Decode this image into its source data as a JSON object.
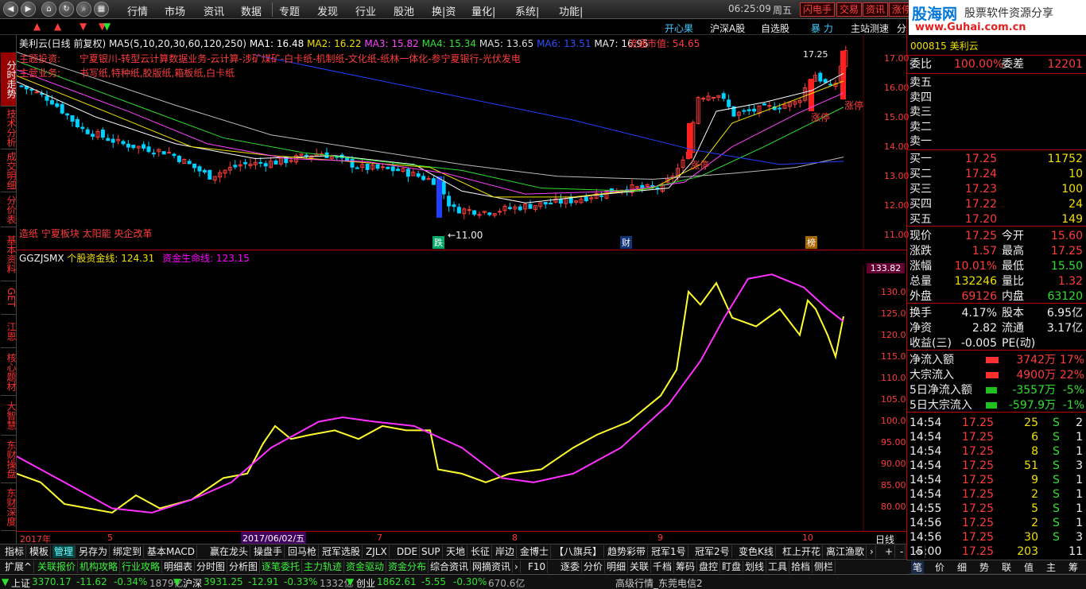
{
  "topbar": {
    "menu": [
      "行情",
      "市场",
      "资讯",
      "数据",
      "专题",
      "发现",
      "行业",
      "股池",
      "换|资",
      "量化|",
      "系统|",
      "功能|"
    ],
    "time": "06:25:09",
    "weekday": "周五",
    "tags": [
      "闪电手",
      "交易",
      "资讯",
      "涨停"
    ],
    "brand_name": "股海网",
    "brand_slogan": "股票软件资源分享",
    "brand_url": "www.Guhai.com.cn"
  },
  "row2": {
    "arrows": [
      "▲",
      "▲",
      "▼",
      "▼",
      "▼"
    ],
    "tabs": [
      "开心果",
      "沪深A股",
      "自选股",
      "暴 力",
      "主站测速",
      "分"
    ]
  },
  "chart_header": {
    "stock": "美利云(日线 前复权)",
    "ma_params": "MA5(5,10,20,30,60,120,250)",
    "ma": [
      {
        "label": "MA1: 16.48",
        "color": "#ffffff"
      },
      {
        "label": "MA2: 16.22",
        "color": "#f0e000"
      },
      {
        "label": "MA3: 15.82",
        "color": "#ff40ff"
      },
      {
        "label": "MA4: 15.34",
        "color": "#30e030"
      },
      {
        "label": "MA5: 13.65",
        "color": "#dddddd"
      },
      {
        "label": "MA6: 13.51",
        "color": "#3050ff"
      },
      {
        "label": "MA7: 16.95",
        "color": "#eeeeee"
      }
    ],
    "float_mv": "流通市值: 54.65",
    "theme_label": "主题投资:",
    "theme_text": "宁夏银川-转型云计算数据业务-云计算-涉矿煤矿-白卡纸-机制纸-文化纸-纸林一体化-参宁夏银行-光伏发电",
    "product_label": "主营业务:",
    "product_text": "书写纸,特种纸,胶版纸,箱板纸,白卡纸",
    "concepts": "造纸 宁夏板块 太阳能 央企改革",
    "low_label": "←11.00",
    "high_label": "17.25",
    "limit_labels": [
      "涨停",
      "涨停",
      "涨停"
    ],
    "event_marks": [
      "跌",
      "财",
      "榜"
    ]
  },
  "price_axis": [
    "17.00",
    "16.00",
    "15.00",
    "14.00",
    "13.00",
    "12.00",
    "11.00"
  ],
  "indicator": {
    "name": "GGZJSMX",
    "line1": "个股资金线: 124.31",
    "line2": "资金生命线: 123.15",
    "current": "133.82",
    "axis": [
      "130.0",
      "125.0",
      "120.0",
      "115.0",
      "110.0",
      "105.0",
      "100.0",
      "95.00",
      "90.00",
      "85.00",
      "80.00"
    ]
  },
  "xaxis": {
    "labels": [
      "2017年",
      "5",
      "2017/06/02/五",
      "7",
      "8",
      "9",
      "10"
    ],
    "period": "日线"
  },
  "quote": {
    "code": "000815 美利云",
    "webi": [
      "委比",
      "100.00%",
      "委差",
      "12201"
    ],
    "sells": [
      [
        "卖五",
        "",
        ""
      ],
      [
        "卖四",
        "",
        ""
      ],
      [
        "卖三",
        "",
        ""
      ],
      [
        "卖二",
        "",
        ""
      ],
      [
        "卖一",
        "",
        ""
      ]
    ],
    "buys": [
      [
        "买一",
        "17.25",
        "11752"
      ],
      [
        "买二",
        "17.24",
        "10"
      ],
      [
        "买三",
        "17.23",
        "100"
      ],
      [
        "买四",
        "17.22",
        "24"
      ],
      [
        "买五",
        "17.20",
        "149"
      ]
    ],
    "stats": [
      [
        "现价",
        "17.25",
        "今开",
        "15.60"
      ],
      [
        "涨跌",
        "1.57",
        "最高",
        "17.25"
      ],
      [
        "涨幅",
        "10.01%",
        "最低",
        "15.50"
      ],
      [
        "总量",
        "132246",
        "量比",
        "1.32"
      ],
      [
        "外盘",
        "69126",
        "内盘",
        "63120"
      ]
    ],
    "stats2": [
      [
        "换手",
        "4.17%",
        "股本",
        "6.95亿"
      ],
      [
        "净资",
        "2.82",
        "流通",
        "3.17亿"
      ],
      [
        "收益(三)",
        "-0.005",
        "PE(动)",
        ""
      ]
    ],
    "flows": [
      [
        "净流入额",
        "3742万",
        "17%"
      ],
      [
        "大宗流入",
        "4900万",
        "22%"
      ],
      [
        "5日净流入额",
        "-3557万",
        "-5%"
      ],
      [
        "5日大宗流入",
        "-597.9万",
        "-1%"
      ]
    ],
    "ticks": [
      [
        "14:54",
        "17.25",
        "25",
        "S",
        "2"
      ],
      [
        "14:54",
        "17.25",
        "6",
        "S",
        "1"
      ],
      [
        "14:54",
        "17.25",
        "8",
        "S",
        "1"
      ],
      [
        "14:54",
        "17.25",
        "51",
        "S",
        "3"
      ],
      [
        "14:54",
        "17.25",
        "9",
        "S",
        "1"
      ],
      [
        "14:54",
        "17.25",
        "2",
        "S",
        "1"
      ],
      [
        "14:55",
        "17.25",
        "5",
        "S",
        "1"
      ],
      [
        "14:56",
        "17.25",
        "2",
        "S",
        "1"
      ],
      [
        "14:56",
        "17.25",
        "30",
        "S",
        "3"
      ],
      [
        "15:00",
        "17.25",
        "203",
        "",
        "11"
      ]
    ],
    "bottom_tabs": [
      "笔",
      "价",
      "细",
      "势",
      "联",
      "值",
      "主",
      "筹"
    ]
  },
  "lefttabs": [
    "分时走势",
    "技术分析",
    "成交明细",
    "分价表",
    "基本资料",
    "GET",
    "江恩",
    "核心题材",
    "大智慧",
    "东财操盘",
    "东财深度"
  ],
  "toolbar1": [
    "指标",
    "模板",
    "管理",
    "另存为",
    "绑定到",
    "基本MACD",
    "赢在龙头",
    "操盘手",
    "回马枪",
    "冠军选股",
    "ZJLX",
    "DDE",
    "SUP",
    "天地",
    "长征",
    "岸边",
    "金博士",
    "【八旗兵】",
    "趋势彩带",
    "冠军1号",
    "冠军2号",
    "变色K线",
    "杠上开花",
    "离江渔歌",
    "›",
    "+",
    "-",
    "⇔"
  ],
  "toolbar2": [
    "扩展^",
    "关联报价",
    "机构攻略",
    "行业攻略",
    "明细表",
    "分时图",
    "分析图",
    "逐笔委托",
    "主力轨迹",
    "资金驱动",
    "资金分布",
    "综合资讯",
    "网摘资讯",
    "›",
    "F10",
    "逐委",
    "分价",
    "明细",
    "关联",
    "千档",
    "筹码",
    "盘控",
    "盯盘",
    "划线",
    "工具",
    "拾档",
    "侧栏"
  ],
  "status": {
    "sh_name": "上证",
    "sh": "3370.17",
    "sh_chg": "-11.62",
    "sh_pct": "-0.34%",
    "sh_amt": "1879亿",
    "hs_name": "沪深",
    "hs": "3931.25",
    "hs_chg": "-12.91",
    "hs_pct": "-0.33%",
    "hs_amt": "1332亿",
    "cy_name": "创业",
    "cy": "1862.61",
    "cy_chg": "-5.55",
    "cy_pct": "-0.30%",
    "cy_amt": "670.6亿",
    "feed": "高级行情_东莞电信2"
  },
  "colors": {
    "up": "#ff3c3c",
    "down": "#00d0ff",
    "fund_line": "#ffff30",
    "life_line": "#ff30ff"
  }
}
